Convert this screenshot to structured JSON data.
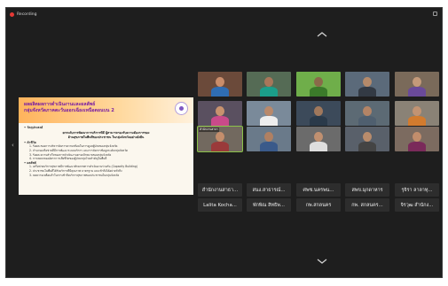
{
  "top_bar": {
    "recording_label": "Recording"
  },
  "slide": {
    "title_line1": "ผลผลิตผลการดำเนินงานและผลลัพธ์",
    "title_line2": "กลุ่มจังหวัดภาคตะวันออกเฉียงเหนือตอนบน 2",
    "lines": [
      {
        "text": "• วัตถุประสงค์",
        "style": "heading"
      },
      {
        "text": "ยกระดับการพัฒนาการบริการที่ดี ผู้สามารถรองรับความต้องการของ",
        "style": "center"
      },
      {
        "text": "ด้านสุขภาพในพื้นที่ของประชาชน ในกลุ่มจังหวัดอย่างยั่งยืน",
        "style": "center"
      },
      {
        "text": "• ตัวชี้วัด",
        "style": "heading"
      },
      {
        "text": "1. ร้อยละของการบริหารจัดการความพร้อมในการดูแลผู้ป่วยของกลุ่มจังหวัด",
        "style": "indent"
      },
      {
        "text": "2. จำนวนเครือข่ายที่มีการพัฒนาระบบบริการ และการจัดการข้อมูลระดับกลุ่มจังหวัด",
        "style": "indent"
      },
      {
        "text": "3. ร้อยละความสำเร็จของการดำเนินงานตามเป้าหมายของกลุ่มจังหวัด",
        "style": "indent"
      },
      {
        "text": "4. การลดลงของอัตราการเสียชีวิตของผู้ป่วยกลุ่มโรคสำคัญในพื้นที่",
        "style": "indent"
      },
      {
        "text": "• ผลลัพธ์",
        "style": "heading"
      },
      {
        "text": "1. เครือข่ายบริการสุขภาพมีการพัฒนาศักยภาพการดำเนินงานร่วมกัน (Capacity Building)",
        "style": "indent"
      },
      {
        "text": "2. ประชาชนในพื้นที่ได้รับบริการที่มีคุณภาพ มาตรฐาน และเข้าถึงได้อย่างทั่วถึง",
        "style": "indent"
      },
      {
        "text": "3. ลดความเหลื่อมล้ำในการเข้าถึงบริการสุขภาพของประชาชนในกลุ่มจังหวัด",
        "style": "indent"
      }
    ]
  },
  "participants": {
    "video_tiles": [
      {
        "label": "",
        "bg": "#6b4a3a",
        "skin": "#c98d6b",
        "shirt": "#2f6db3"
      },
      {
        "label": "",
        "bg": "#556b55",
        "skin": "#a8765a",
        "shirt": "#1b9e8a"
      },
      {
        "label": "",
        "bg": "#6fae4a",
        "skin": "#8a6a4a",
        "shirt": "#3b7a2a"
      },
      {
        "label": "",
        "bg": "#5b6a7a",
        "skin": "#b58a6a",
        "shirt": "#333a44"
      },
      {
        "label": "",
        "bg": "#7a6a5a",
        "skin": "#c49a7a",
        "shirt": "#6a4a9a"
      },
      {
        "label": "",
        "bg": "#5a5060",
        "skin": "#c8926e",
        "shirt": "#c94a8a"
      },
      {
        "label": "",
        "bg": "#7a8a9a",
        "skin": "#b9896b",
        "shirt": "#eeeeee"
      },
      {
        "label": "",
        "bg": "#3c4a5a",
        "skin": "#a0785c",
        "shirt": "#2a3a4a"
      },
      {
        "label": "",
        "bg": "#5c6a74",
        "skin": "#b38466",
        "shirt": "#4f5f6f"
      },
      {
        "label": "",
        "bg": "#8a8276",
        "skin": "#c29372",
        "shirt": "#d27b2e"
      },
      {
        "label": "",
        "bg": "#72695f",
        "skin": "#c48e6c",
        "shirt": "#9a3a3a"
      },
      {
        "label": "",
        "bg": "#6a7a8a",
        "skin": "#b08062",
        "shirt": "#3a5a8a"
      },
      {
        "label": "",
        "bg": "#6b6b6b",
        "skin": "#c09070",
        "shirt": "#dedede"
      },
      {
        "label": "",
        "bg": "#59606a",
        "skin": "#b98c6c",
        "shirt": "#444444"
      },
      {
        "label": "",
        "bg": "#7c6b60",
        "skin": "#c18d6c",
        "shirt": "#7a2a5a"
      }
    ],
    "name_tiles": [
      "สำนักงานสาธา...",
      "สนง.สาธารณ์...",
      "ศพช.นครพน...",
      "สพข.มุกดาหาร",
      "รุจิรา ลาลาทุ...",
      "Lalita Kocha...",
      "พักพิณ สิทธิพ...",
      "กพ.สกลนคร",
      "กพ. สกลนคร...",
      "จิรวุฒ สำนักง..."
    ],
    "speaker_tag": "สำนักงานสาธา"
  }
}
